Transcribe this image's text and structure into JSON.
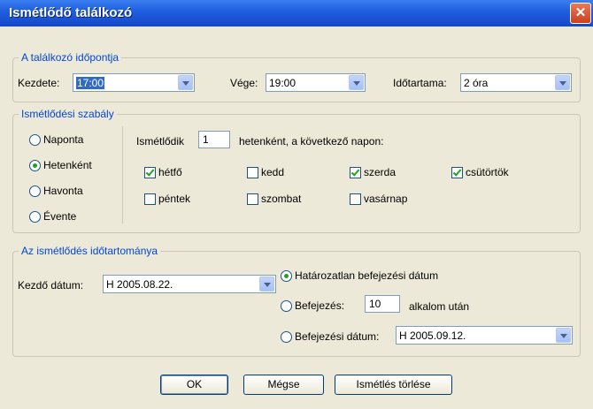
{
  "window": {
    "title": "Ismétlődő találkozó",
    "close_glyph": "✕"
  },
  "time_group": {
    "legend": "A találkozó időpontja",
    "start_label": "Kezdete:",
    "start_value": "17:00",
    "end_label": "Vége:",
    "end_value": "19:00",
    "duration_label": "Időtartama:",
    "duration_value": "2 óra"
  },
  "rule_group": {
    "legend": "Ismétlődési szabály",
    "options": [
      {
        "label": "Naponta",
        "selected": false
      },
      {
        "label": "Hetenként",
        "selected": true
      },
      {
        "label": "Havonta",
        "selected": false
      },
      {
        "label": "Évente",
        "selected": false
      }
    ],
    "recur_label": "Ismétlődik",
    "recur_value": "1",
    "recur_suffix": "hetenként, a következő napon:",
    "days": [
      {
        "label": "hétfő",
        "checked": true
      },
      {
        "label": "kedd",
        "checked": false
      },
      {
        "label": "szerda",
        "checked": true
      },
      {
        "label": "csütörtök",
        "checked": true
      },
      {
        "label": "péntek",
        "checked": false
      },
      {
        "label": "szombat",
        "checked": false
      },
      {
        "label": "vasárnap",
        "checked": false
      }
    ]
  },
  "range_group": {
    "legend": "Az ismétlődés időtartománya",
    "start_label": "Kezdő dátum:",
    "start_value": "H 2005.08.22.",
    "no_end_label": "Határozatlan befejezési dátum",
    "end_after_label": "Befejezés:",
    "end_after_value": "10",
    "end_after_suffix": "alkalom után",
    "end_by_label": "Befejezési dátum:",
    "end_by_value": "H 2005.09.12.",
    "selected": "no_end"
  },
  "buttons": {
    "ok": "OK",
    "cancel": "Mégse",
    "remove": "Ismétlés törlése"
  },
  "colors": {
    "accent": "#0046d5",
    "title_bar": "#1f5fe0",
    "dialog_bg": "#ece9d8",
    "check_green": "#21a121"
  }
}
